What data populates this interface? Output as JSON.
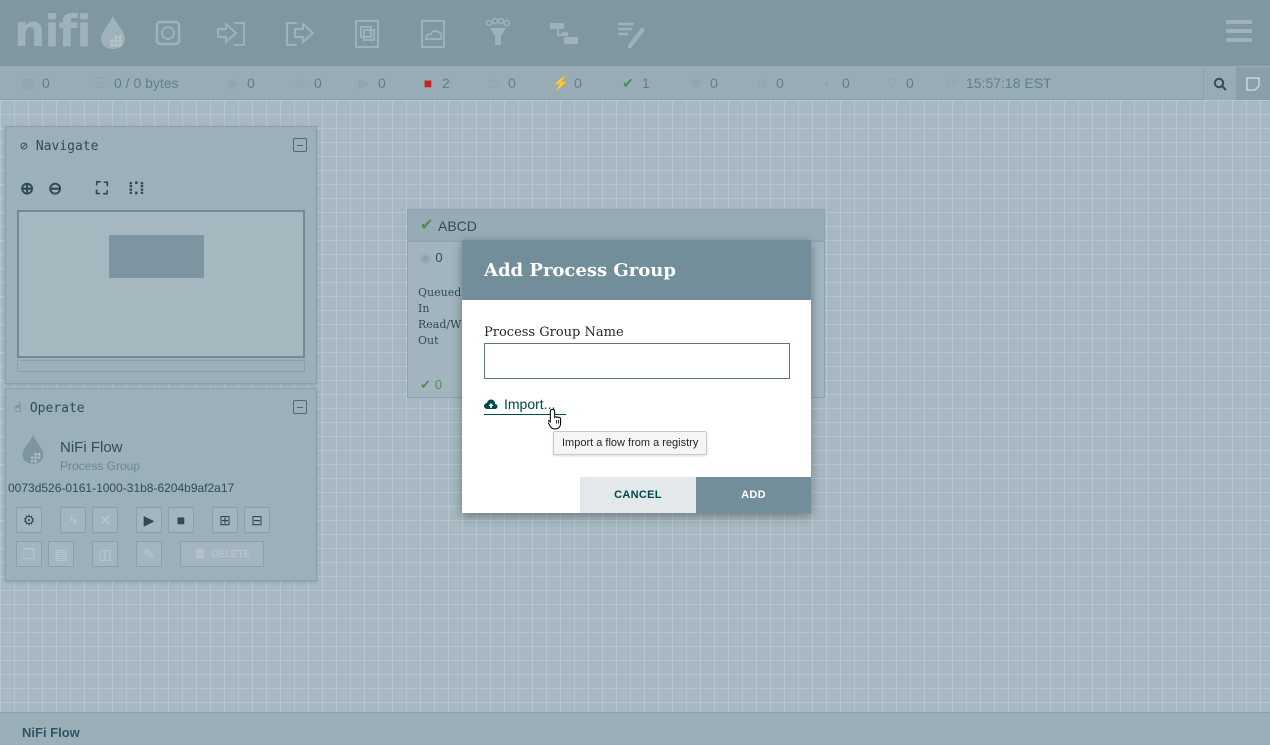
{
  "header": {
    "logo_text": "nifi",
    "toolbar": [
      {
        "name": "processor-icon"
      },
      {
        "name": "input-port-icon"
      },
      {
        "name": "output-port-icon"
      },
      {
        "name": "process-group-icon"
      },
      {
        "name": "remote-process-group-icon"
      },
      {
        "name": "funnel-icon"
      },
      {
        "name": "template-icon"
      },
      {
        "name": "label-icon"
      }
    ]
  },
  "status": {
    "cluster": "0",
    "queued": "0 / 0 bytes",
    "transmitting": "0",
    "not_transmitting": "0",
    "running": "0",
    "stopped": "2",
    "invalid": "0",
    "disabled": "0",
    "up_to_date": "1",
    "locally_modified": "0",
    "stale": "0",
    "locally_modified_stale": "0",
    "sync_failure": "0",
    "last_refresh": "15:57:18 EST"
  },
  "navigate": {
    "title": "Navigate"
  },
  "operate": {
    "title": "Operate",
    "component_name": "NiFi Flow",
    "component_type": "Process Group",
    "component_id": "0073d526-0161-1000-31b8-6204b9af2a17",
    "delete_label": "DELETE"
  },
  "process_group": {
    "name": "ABCD",
    "count": "0",
    "rows": [
      "Queued",
      "In",
      "Read/W",
      "Out"
    ],
    "footer_count": "0"
  },
  "breadcrumb": {
    "current": "NiFi Flow"
  },
  "dialog": {
    "title": "Add Process Group",
    "field_label": "Process Group Name",
    "name_value": "",
    "import_label": "Import...",
    "tooltip": "Import a flow from a registry",
    "cancel_label": "CANCEL",
    "add_label": "ADD"
  },
  "colors": {
    "header_bg": "#7f97a1",
    "dialog_header": "#728e9b",
    "link": "#004849",
    "ok_green": "#4e8c57",
    "stopped_red": "#c62626"
  }
}
